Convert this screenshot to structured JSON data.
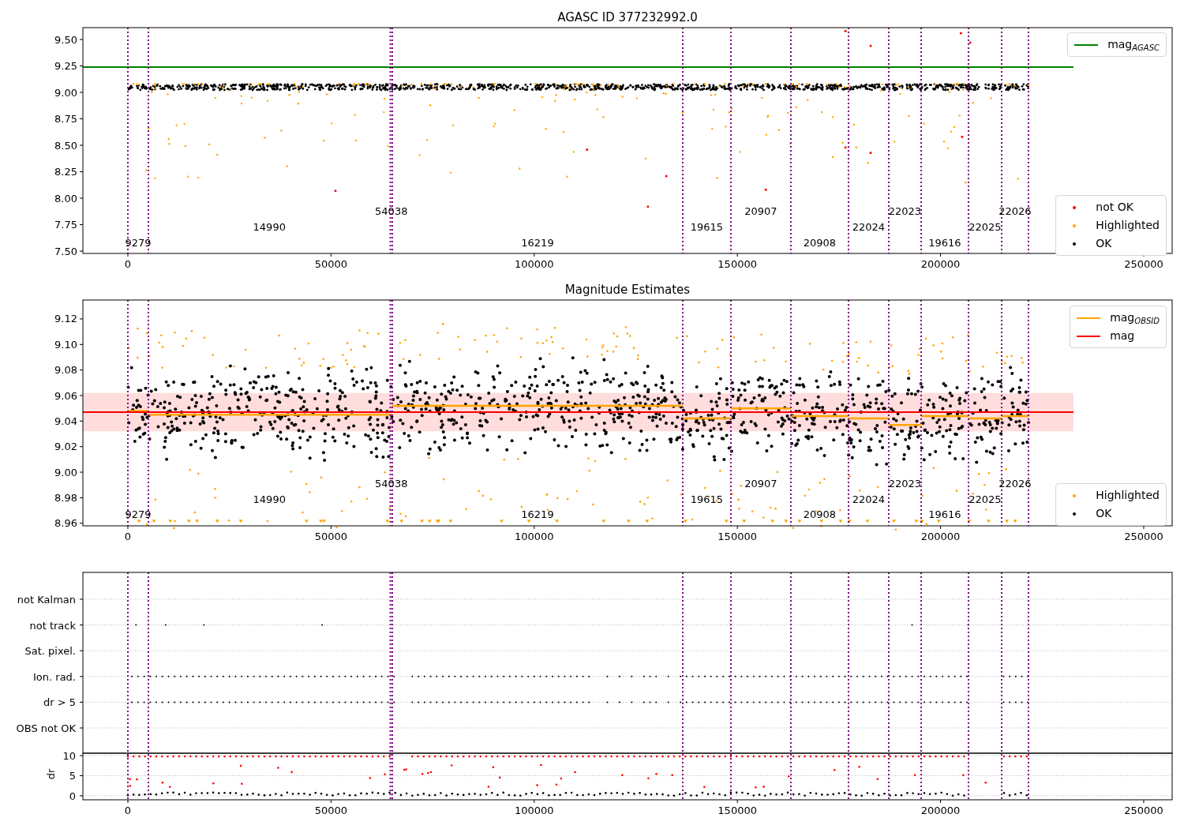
{
  "figure": {
    "panels": [
      {
        "title": "AGASC ID 377232992.0",
        "chart_data": {
          "type": "line",
          "xlim": [
            -11070,
            257000
          ],
          "ylim": [
            7.478,
            9.612
          ],
          "xticks": [
            0,
            50000,
            100000,
            150000,
            200000,
            250000
          ],
          "yticks": [
            {
              "value": 7.5,
              "label": "7.50"
            },
            {
              "value": 7.75,
              "label": "7.75"
            },
            {
              "value": 8.0,
              "label": "8.00"
            },
            {
              "value": 8.25,
              "label": "8.25"
            },
            {
              "value": 8.5,
              "label": "8.50"
            },
            {
              "value": 8.75,
              "label": "8.75"
            },
            {
              "value": 9.0,
              "label": "9.00"
            },
            {
              "value": 9.25,
              "label": "9.25"
            },
            {
              "value": 9.5,
              "label": "9.50"
            }
          ],
          "series": [
            {
              "name": "mag$_{AGASC}$",
              "color": "#008000",
              "x": [
                -11070,
                232700
              ],
              "values": [
                9.24,
                9.24
              ]
            }
          ],
          "ref_lines": [
            {
              "axis": "x",
              "value": 0
            },
            {
              "axis": "x",
              "value": 5050
            },
            {
              "axis": "x",
              "value": 64600
            },
            {
              "axis": "x",
              "value": 65074
            },
            {
              "axis": "x",
              "value": 136558
            },
            {
              "axis": "x",
              "value": 148407
            },
            {
              "axis": "x",
              "value": 163170
            },
            {
              "axis": "x",
              "value": 177350
            },
            {
              "axis": "x",
              "value": 187257
            },
            {
              "axis": "x",
              "value": 195221
            },
            {
              "axis": "x",
              "value": 206876
            },
            {
              "axis": "x",
              "value": 215035
            },
            {
              "axis": "x",
              "value": 221640
            }
          ],
          "annotations": [
            "9279",
            "14990",
            "54038",
            "16219",
            "19615",
            "20907",
            "20908",
            "22024",
            "22023",
            "19616",
            "22025",
            "22026"
          ]
        },
        "point_legend": [
          {
            "label": "not OK",
            "color": "#ff0000"
          },
          {
            "label": "Highlighted",
            "color": "#ffa500"
          },
          {
            "label": "OK",
            "color": "#000000"
          }
        ]
      },
      {
        "title": "Magnitude Estimates",
        "chart_data": {
          "type": "line",
          "xlim": [
            -11070,
            257000
          ],
          "ylim": [
            8.958,
            9.1348
          ],
          "xticks": [
            0,
            50000,
            100000,
            150000,
            200000,
            250000
          ],
          "yticks": [
            {
              "value": 8.96,
              "label": "8.96"
            },
            {
              "value": 8.98,
              "label": "8.98"
            },
            {
              "value": 9.0,
              "label": "9.00"
            },
            {
              "value": 9.02,
              "label": "9.02"
            },
            {
              "value": 9.04,
              "label": "9.04"
            },
            {
              "value": 9.06,
              "label": "9.06"
            },
            {
              "value": 9.08,
              "label": "9.08"
            },
            {
              "value": 9.1,
              "label": "9.10"
            },
            {
              "value": 9.12,
              "label": "9.12"
            }
          ],
          "series": [
            {
              "name": "mag$_{OBSID}$",
              "color": "#ffa500",
              "x": [
                0,
                5050,
                5050,
                65074,
                65074,
                136558,
                136558,
                148407,
                148407,
                163170,
                163170,
                177350,
                177350,
                187257,
                187257,
                195221,
                195221,
                206876,
                206876,
                215035,
                215035,
                221640
              ],
              "values": [
                9.048,
                9.048,
                9.045,
                9.045,
                9.052,
                9.052,
                9.042,
                9.042,
                9.05,
                9.05,
                9.044,
                9.044,
                9.042,
                9.042,
                9.037,
                9.037,
                9.044,
                9.044,
                9.042,
                9.042,
                9.044,
                9.044
              ]
            },
            {
              "name": "mag",
              "color": "#ff0000",
              "x": [
                -11070,
                232700
              ],
              "values": [
                9.047,
                9.047
              ]
            }
          ],
          "bands": [
            {
              "axis": "y",
              "from": 9.032,
              "to": 9.062,
              "color": "#ffdddd"
            }
          ],
          "ref_lines": [
            {
              "axis": "x",
              "value": 0
            },
            {
              "axis": "x",
              "value": 5050
            },
            {
              "axis": "x",
              "value": 64600
            },
            {
              "axis": "x",
              "value": 65074
            },
            {
              "axis": "x",
              "value": 136558
            },
            {
              "axis": "x",
              "value": 148407
            },
            {
              "axis": "x",
              "value": 163170
            },
            {
              "axis": "x",
              "value": 177350
            },
            {
              "axis": "x",
              "value": 187257
            },
            {
              "axis": "x",
              "value": 195221
            },
            {
              "axis": "x",
              "value": 206876
            },
            {
              "axis": "x",
              "value": 215035
            },
            {
              "axis": "x",
              "value": 221640
            }
          ],
          "annotations": [
            "9279",
            "14990",
            "54038",
            "16219",
            "19615",
            "20907",
            "20908",
            "22024",
            "22023",
            "19616",
            "22025",
            "22026"
          ]
        },
        "point_legend": [
          {
            "label": "Highlighted",
            "color": "#ffa500"
          },
          {
            "label": "OK",
            "color": "#000000"
          }
        ]
      },
      {
        "chart_data": {
          "type": "scatter",
          "ylabel": "dr",
          "grid": true,
          "xlim": [
            -11070,
            257000
          ],
          "ylim": [
            -1,
            10.6
          ],
          "xticks": [
            0,
            50000,
            100000,
            150000,
            200000,
            250000
          ],
          "yticks": [
            0,
            5,
            10
          ],
          "ref_lines": [
            {
              "axis": "x",
              "value": 0
            },
            {
              "axis": "x",
              "value": 5050
            },
            {
              "axis": "x",
              "value": 64600
            },
            {
              "axis": "x",
              "value": 65074
            },
            {
              "axis": "x",
              "value": 136558
            },
            {
              "axis": "x",
              "value": 148407
            },
            {
              "axis": "x",
              "value": 163170
            },
            {
              "axis": "x",
              "value": 177350
            },
            {
              "axis": "x",
              "value": 187257
            },
            {
              "axis": "x",
              "value": 195221
            },
            {
              "axis": "x",
              "value": 206876
            },
            {
              "axis": "x",
              "value": 215035
            },
            {
              "axis": "x",
              "value": 221640
            }
          ]
        },
        "flag_rows": [
          "not Kalman",
          "not track",
          "Sat. pixel.",
          "Ion. rad.",
          "dr > 5",
          "OBS not OK"
        ]
      }
    ]
  }
}
